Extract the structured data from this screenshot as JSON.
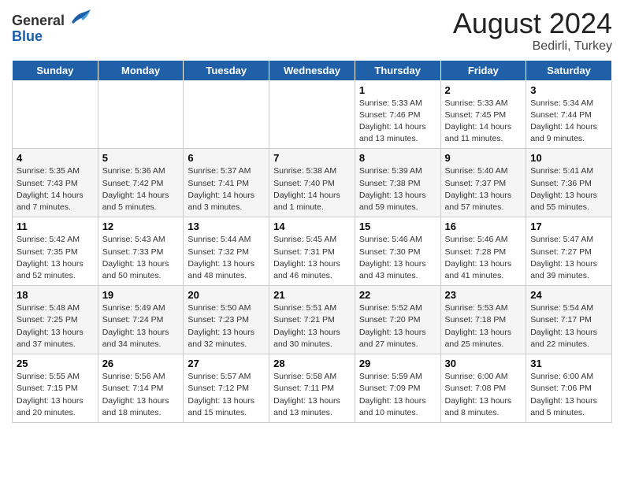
{
  "header": {
    "logo_general": "General",
    "logo_blue": "Blue",
    "month": "August 2024",
    "location": "Bedirli, Turkey"
  },
  "weekdays": [
    "Sunday",
    "Monday",
    "Tuesday",
    "Wednesday",
    "Thursday",
    "Friday",
    "Saturday"
  ],
  "weeks": [
    [
      {
        "day": "",
        "info": ""
      },
      {
        "day": "",
        "info": ""
      },
      {
        "day": "",
        "info": ""
      },
      {
        "day": "",
        "info": ""
      },
      {
        "day": "1",
        "info": "Sunrise: 5:33 AM\nSunset: 7:46 PM\nDaylight: 14 hours\nand 13 minutes."
      },
      {
        "day": "2",
        "info": "Sunrise: 5:33 AM\nSunset: 7:45 PM\nDaylight: 14 hours\nand 11 minutes."
      },
      {
        "day": "3",
        "info": "Sunrise: 5:34 AM\nSunset: 7:44 PM\nDaylight: 14 hours\nand 9 minutes."
      }
    ],
    [
      {
        "day": "4",
        "info": "Sunrise: 5:35 AM\nSunset: 7:43 PM\nDaylight: 14 hours\nand 7 minutes."
      },
      {
        "day": "5",
        "info": "Sunrise: 5:36 AM\nSunset: 7:42 PM\nDaylight: 14 hours\nand 5 minutes."
      },
      {
        "day": "6",
        "info": "Sunrise: 5:37 AM\nSunset: 7:41 PM\nDaylight: 14 hours\nand 3 minutes."
      },
      {
        "day": "7",
        "info": "Sunrise: 5:38 AM\nSunset: 7:40 PM\nDaylight: 14 hours\nand 1 minute."
      },
      {
        "day": "8",
        "info": "Sunrise: 5:39 AM\nSunset: 7:38 PM\nDaylight: 13 hours\nand 59 minutes."
      },
      {
        "day": "9",
        "info": "Sunrise: 5:40 AM\nSunset: 7:37 PM\nDaylight: 13 hours\nand 57 minutes."
      },
      {
        "day": "10",
        "info": "Sunrise: 5:41 AM\nSunset: 7:36 PM\nDaylight: 13 hours\nand 55 minutes."
      }
    ],
    [
      {
        "day": "11",
        "info": "Sunrise: 5:42 AM\nSunset: 7:35 PM\nDaylight: 13 hours\nand 52 minutes."
      },
      {
        "day": "12",
        "info": "Sunrise: 5:43 AM\nSunset: 7:33 PM\nDaylight: 13 hours\nand 50 minutes."
      },
      {
        "day": "13",
        "info": "Sunrise: 5:44 AM\nSunset: 7:32 PM\nDaylight: 13 hours\nand 48 minutes."
      },
      {
        "day": "14",
        "info": "Sunrise: 5:45 AM\nSunset: 7:31 PM\nDaylight: 13 hours\nand 46 minutes."
      },
      {
        "day": "15",
        "info": "Sunrise: 5:46 AM\nSunset: 7:30 PM\nDaylight: 13 hours\nand 43 minutes."
      },
      {
        "day": "16",
        "info": "Sunrise: 5:46 AM\nSunset: 7:28 PM\nDaylight: 13 hours\nand 41 minutes."
      },
      {
        "day": "17",
        "info": "Sunrise: 5:47 AM\nSunset: 7:27 PM\nDaylight: 13 hours\nand 39 minutes."
      }
    ],
    [
      {
        "day": "18",
        "info": "Sunrise: 5:48 AM\nSunset: 7:25 PM\nDaylight: 13 hours\nand 37 minutes."
      },
      {
        "day": "19",
        "info": "Sunrise: 5:49 AM\nSunset: 7:24 PM\nDaylight: 13 hours\nand 34 minutes."
      },
      {
        "day": "20",
        "info": "Sunrise: 5:50 AM\nSunset: 7:23 PM\nDaylight: 13 hours\nand 32 minutes."
      },
      {
        "day": "21",
        "info": "Sunrise: 5:51 AM\nSunset: 7:21 PM\nDaylight: 13 hours\nand 30 minutes."
      },
      {
        "day": "22",
        "info": "Sunrise: 5:52 AM\nSunset: 7:20 PM\nDaylight: 13 hours\nand 27 minutes."
      },
      {
        "day": "23",
        "info": "Sunrise: 5:53 AM\nSunset: 7:18 PM\nDaylight: 13 hours\nand 25 minutes."
      },
      {
        "day": "24",
        "info": "Sunrise: 5:54 AM\nSunset: 7:17 PM\nDaylight: 13 hours\nand 22 minutes."
      }
    ],
    [
      {
        "day": "25",
        "info": "Sunrise: 5:55 AM\nSunset: 7:15 PM\nDaylight: 13 hours\nand 20 minutes."
      },
      {
        "day": "26",
        "info": "Sunrise: 5:56 AM\nSunset: 7:14 PM\nDaylight: 13 hours\nand 18 minutes."
      },
      {
        "day": "27",
        "info": "Sunrise: 5:57 AM\nSunset: 7:12 PM\nDaylight: 13 hours\nand 15 minutes."
      },
      {
        "day": "28",
        "info": "Sunrise: 5:58 AM\nSunset: 7:11 PM\nDaylight: 13 hours\nand 13 minutes."
      },
      {
        "day": "29",
        "info": "Sunrise: 5:59 AM\nSunset: 7:09 PM\nDaylight: 13 hours\nand 10 minutes."
      },
      {
        "day": "30",
        "info": "Sunrise: 6:00 AM\nSunset: 7:08 PM\nDaylight: 13 hours\nand 8 minutes."
      },
      {
        "day": "31",
        "info": "Sunrise: 6:00 AM\nSunset: 7:06 PM\nDaylight: 13 hours\nand 5 minutes."
      }
    ]
  ]
}
